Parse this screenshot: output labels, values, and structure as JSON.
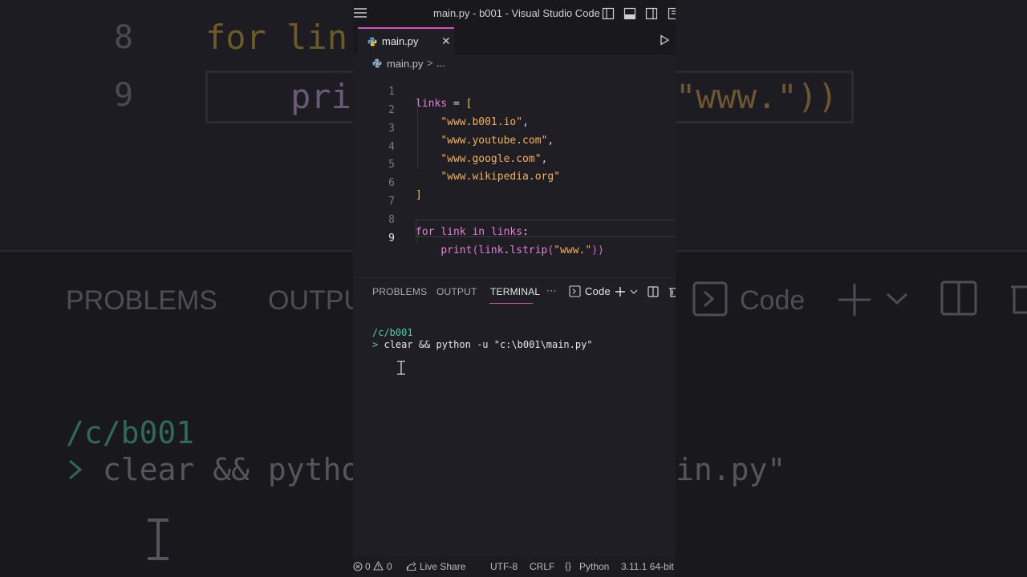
{
  "window": {
    "title": "main.py - b001 - Visual Studio Code"
  },
  "tabs": [
    {
      "label": "main.py",
      "active": true
    }
  ],
  "breadcrumb": {
    "file": "main.py",
    "separator": ">",
    "more": "..."
  },
  "editor": {
    "language": "python",
    "current_line": 9,
    "lines": [
      {
        "num": "1",
        "text": "links = ["
      },
      {
        "num": "2",
        "text": "    \"www.b001.io\","
      },
      {
        "num": "3",
        "text": "    \"www.youtube.com\","
      },
      {
        "num": "4",
        "text": "    \"www.google.com\","
      },
      {
        "num": "5",
        "text": "    \"www.wikipedia.org\""
      },
      {
        "num": "6",
        "text": "]"
      },
      {
        "num": "7",
        "text": ""
      },
      {
        "num": "8",
        "text": "for link in links:"
      },
      {
        "num": "9",
        "text": "    print(link.lstrip(\"www.\"))"
      }
    ]
  },
  "panel": {
    "tabs": [
      "PROBLEMS",
      "OUTPUT",
      "TERMINAL"
    ],
    "active_tab": "TERMINAL",
    "more": "···",
    "terminal_name": "Code"
  },
  "terminal": {
    "cwd": "/c/b001",
    "prompt": ">",
    "command": "clear && python -u \"c:\\b001\\main.py\""
  },
  "statusbar": {
    "errors": "0",
    "warnings": "0",
    "live_share": "Live Share",
    "encoding": "UTF-8",
    "eol": "CRLF",
    "language": "Python",
    "interpreter": "3.11.1 64-bit"
  },
  "background": {
    "line_8_num": "8",
    "line_9_num": "9",
    "line_8_code": "for lin",
    "line_9_code": "pri",
    "line_9_tail": "\"www.\"))",
    "panel_problems": "PROBLEMS",
    "panel_output": "OUTPU",
    "panel_code": "Code",
    "term_path": "/c/b001",
    "term_cmd": "clear && pytho",
    "term_tail": "in.py\""
  },
  "colors": {
    "accent": "#d452b3",
    "keyword": "#e77fd2",
    "string": "#f2b25b",
    "bracket": "#e5c84a",
    "terminal_path": "#4fd3a3"
  }
}
